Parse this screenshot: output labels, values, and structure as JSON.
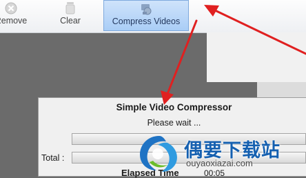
{
  "toolbar": {
    "remove_label": "Remove",
    "clear_label": "Clear",
    "compress_label": "Compress Videos"
  },
  "dialog": {
    "title": "Simple Video Compressor",
    "status": "Please wait ...",
    "total_label": "Total :",
    "elapsed_label": "Elapsed Time",
    "elapsed_value": "00:05"
  },
  "watermark": {
    "title": "偶要下载站",
    "url": "ouyaoxiazai.com"
  },
  "colors": {
    "annotation_arrow": "#e02020",
    "selected_button": "#a9cdf6",
    "watermark_text": "#1560b0"
  },
  "icons": [
    "remove-icon",
    "clear-icon",
    "compress-videos-icon",
    "watermark-logo"
  ]
}
